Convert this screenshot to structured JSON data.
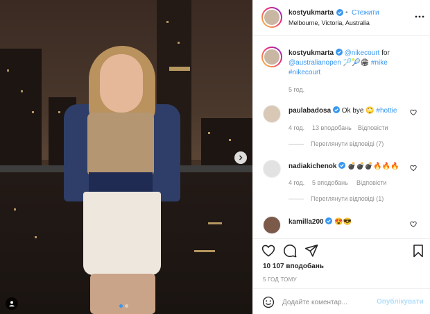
{
  "post": {
    "author": "kostyukmarta",
    "follow_label": "Стежити",
    "location": "Melbourne, Victoria, Australia",
    "caption": {
      "mention1": "@nikecourt",
      "text1": " for ",
      "mention2": "@australianopen",
      "emoji": " 🏸🎾🏟 ",
      "tag1": "#nike",
      "tag2": "#nikecourt"
    },
    "caption_time": "5 год.",
    "likes": "10 107 вподобань",
    "time_ago": "5 ГОД ТОМУ"
  },
  "comments": [
    {
      "author": "paulabadosa",
      "text": "Ok bye 🙄 ",
      "tag": "#hottie",
      "time": "4 год.",
      "likes": "13 вподобань",
      "reply_label": "Відповісти",
      "view_replies": "Переглянути відповіді (7)"
    },
    {
      "author": "nadiakichenok",
      "text": "💣💣💣🔥🔥🔥",
      "time": "4 год.",
      "likes": "5 вподобань",
      "reply_label": "Відповісти",
      "view_replies": "Переглянути відповіді (1)"
    },
    {
      "author": "kamilla200",
      "text": "😍😎"
    }
  ],
  "add_comment": {
    "placeholder": "Додайте коментар...",
    "publish_label": "Опублікувати"
  },
  "icons": {
    "verified": "verified-badge-icon",
    "more": "more-options-icon",
    "like": "heart-icon",
    "comment": "comment-icon",
    "share": "paper-plane-icon",
    "save": "bookmark-icon",
    "emoji": "smiley-icon",
    "next": "chevron-right-icon",
    "tag": "person-tag-icon"
  },
  "colors": {
    "accent": "#3897f0",
    "text": "#262626",
    "muted": "#8e8e8e",
    "publish_disabled": "#b2dffc"
  }
}
